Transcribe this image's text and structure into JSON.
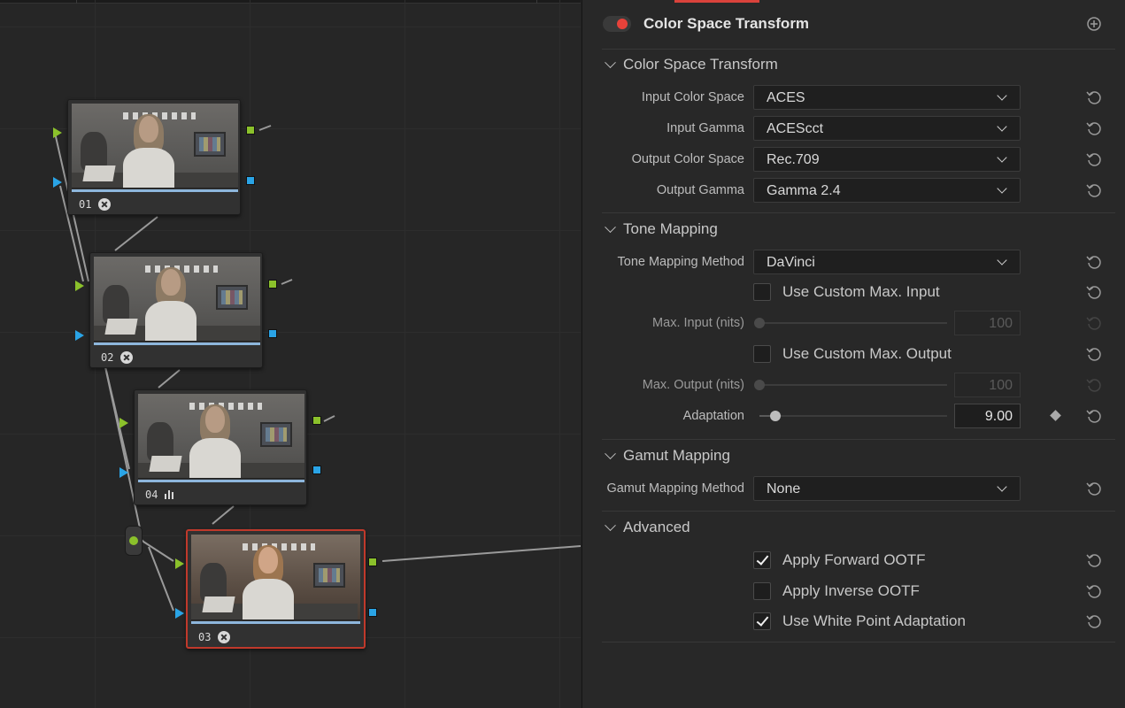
{
  "node_editor": {
    "nodes": [
      {
        "id": "01",
        "badge": "fx-icon"
      },
      {
        "id": "02",
        "badge": "fx-icon"
      },
      {
        "id": "04",
        "badge": "bars-icon"
      },
      {
        "id": "03",
        "badge": "fx-icon",
        "selected": true
      }
    ]
  },
  "inspector": {
    "title": "Color Space Transform",
    "sections": {
      "cst": {
        "title": "Color Space Transform",
        "rows": [
          {
            "label": "Input Color Space",
            "value": "ACES"
          },
          {
            "label": "Input Gamma",
            "value": "ACEScct"
          },
          {
            "label": "Output Color Space",
            "value": "Rec.709"
          },
          {
            "label": "Output Gamma",
            "value": "Gamma 2.4"
          }
        ]
      },
      "tone": {
        "title": "Tone Mapping",
        "method_label": "Tone Mapping Method",
        "method_value": "DaVinci",
        "custom_input_label": "Use Custom Max. Input",
        "custom_input_checked": false,
        "max_input_label": "Max. Input (nits)",
        "max_input_value": "100",
        "custom_output_label": "Use Custom Max. Output",
        "custom_output_checked": false,
        "max_output_label": "Max. Output (nits)",
        "max_output_value": "100",
        "adaptation_label": "Adaptation",
        "adaptation_value": "9.00"
      },
      "gamut": {
        "title": "Gamut Mapping",
        "method_label": "Gamut Mapping Method",
        "method_value": "None"
      },
      "advanced": {
        "title": "Advanced",
        "forward_ootf_label": "Apply Forward OOTF",
        "forward_ootf_checked": true,
        "inverse_ootf_label": "Apply Inverse OOTF",
        "inverse_ootf_checked": false,
        "white_point_label": "Use White Point Adaptation",
        "white_point_checked": true
      }
    },
    "colors": {
      "accent_red": "#e8423a",
      "green_port": "#8bc12b",
      "blue_port": "#2aa4e6"
    }
  }
}
